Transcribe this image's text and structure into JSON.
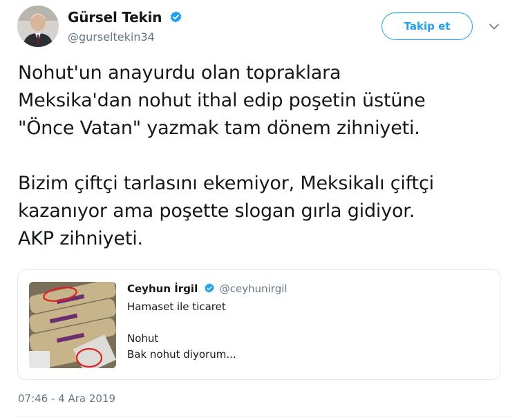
{
  "author": {
    "name": "Gürsel Tekin",
    "handle": "@gurseltekin34",
    "verified": true
  },
  "follow_button": {
    "label": "Takip et"
  },
  "tweet": {
    "paragraph1": [
      "Nohut'un anayurdu olan topraklara",
      "Meksika'dan nohut ithal edip poşetin üstüne",
      "\"Önce Vatan\" yazmak tam dönem zihniyeti."
    ],
    "paragraph2": [
      "Bizim çiftçi tarlasını ekemiyor, Meksikalı çiftçi",
      "kazanıyor ama poşette slogan gırla gidiyor.",
      "AKP zihniyeti."
    ]
  },
  "quote": {
    "name": "Ceyhun İrgil",
    "handle": "@ceyhunirgil",
    "verified": true,
    "lines": [
      "Hamaset ile ticaret",
      "Nohut",
      "Bak nohut diyorum..."
    ]
  },
  "timestamp": "07:46 - 4 Ara 2019",
  "colors": {
    "accent": "#1da1f2",
    "secondary_text": "#657786",
    "border": "#e1e8ed"
  }
}
